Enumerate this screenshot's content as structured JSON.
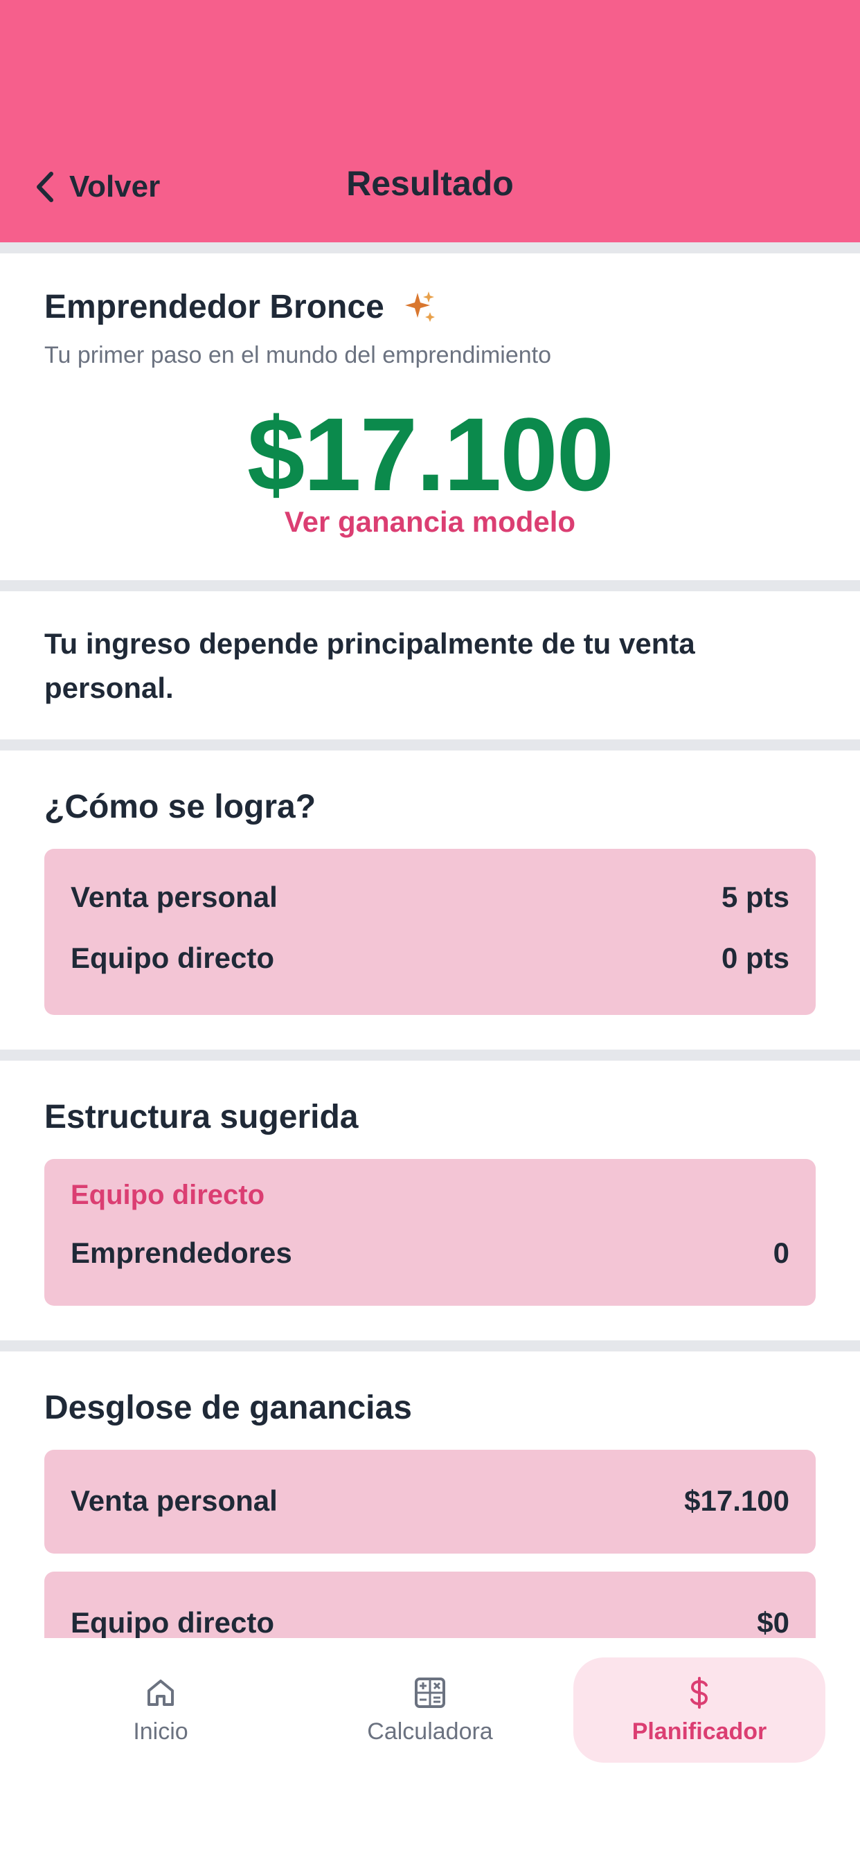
{
  "header": {
    "back_label": "Volver",
    "title": "Resultado"
  },
  "level": {
    "name": "Emprendedor Bronce",
    "subtitle": "Tu primer paso en el mundo del emprendimiento",
    "amount": "$17.100",
    "model_link": "Ver ganancia modelo"
  },
  "note": "Tu ingreso depende principalmente de tu venta personal.",
  "how": {
    "title": "¿Cómo se logra?",
    "rows": [
      {
        "label": "Venta personal",
        "value": "5 pts"
      },
      {
        "label": "Equipo directo",
        "value": "0 pts"
      }
    ]
  },
  "structure": {
    "title": "Estructura sugerida",
    "group_label": "Equipo directo",
    "rows": [
      {
        "label": "Emprendedores",
        "value": "0"
      }
    ]
  },
  "breakdown": {
    "title": "Desglose de ganancias",
    "rows": [
      {
        "label": "Venta personal",
        "value": "$17.100"
      },
      {
        "label": "Equipo directo",
        "value": "$0"
      }
    ]
  },
  "nav": {
    "items": [
      {
        "label": "Inicio",
        "icon": "home-icon"
      },
      {
        "label": "Calculadora",
        "icon": "calculator-icon"
      },
      {
        "label": "Planificador",
        "icon": "dollar-icon"
      }
    ],
    "active": "Planificador"
  },
  "colors": {
    "header": "#f65f8c",
    "accent": "#db3e72",
    "amount": "#0b8a4c",
    "card": "#f3c5d5"
  }
}
